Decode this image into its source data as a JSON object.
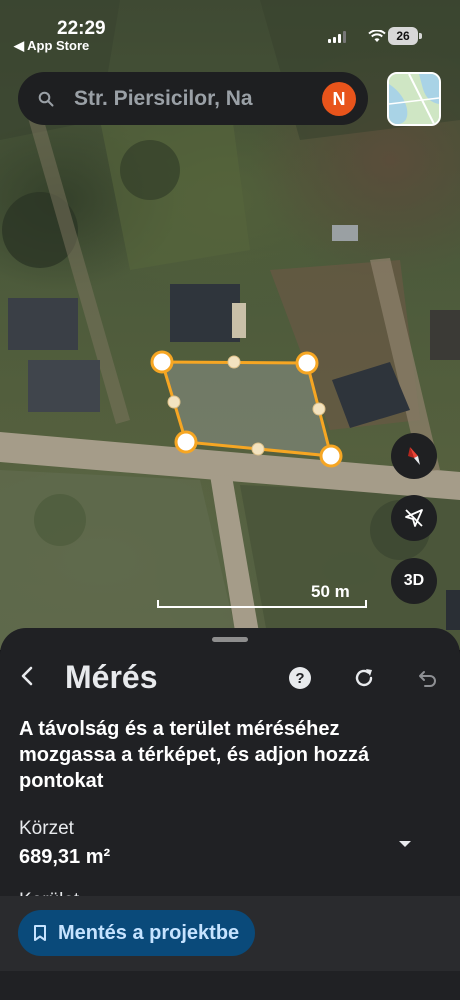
{
  "status_bar": {
    "time": "22:29",
    "back_app": "◀ App Store",
    "battery": "26"
  },
  "search": {
    "query": "Str. Piersicilor, Na",
    "avatar_initial": "N"
  },
  "map": {
    "scale_label": "50 m",
    "buttons": [
      "compass",
      "recenter",
      "3D"
    ],
    "three_d_label": "3D",
    "polygon_color": "#f6a623"
  },
  "sheet": {
    "title": "Mérés",
    "instruction": "A távolság és a terület méréséhez mozgassa a térképet, és adjon hozzá pontokat",
    "area_label": "Körzet",
    "area_value": "689,31 m²",
    "perimeter_label_partial": "Kerület",
    "save_button": "Mentés a projektbe"
  },
  "colors": {
    "sheet_bg": "#202124",
    "save_button_bg": "#0a4a7a",
    "save_button_text": "#c6e3ff",
    "avatar_bg": "#e8541b"
  }
}
